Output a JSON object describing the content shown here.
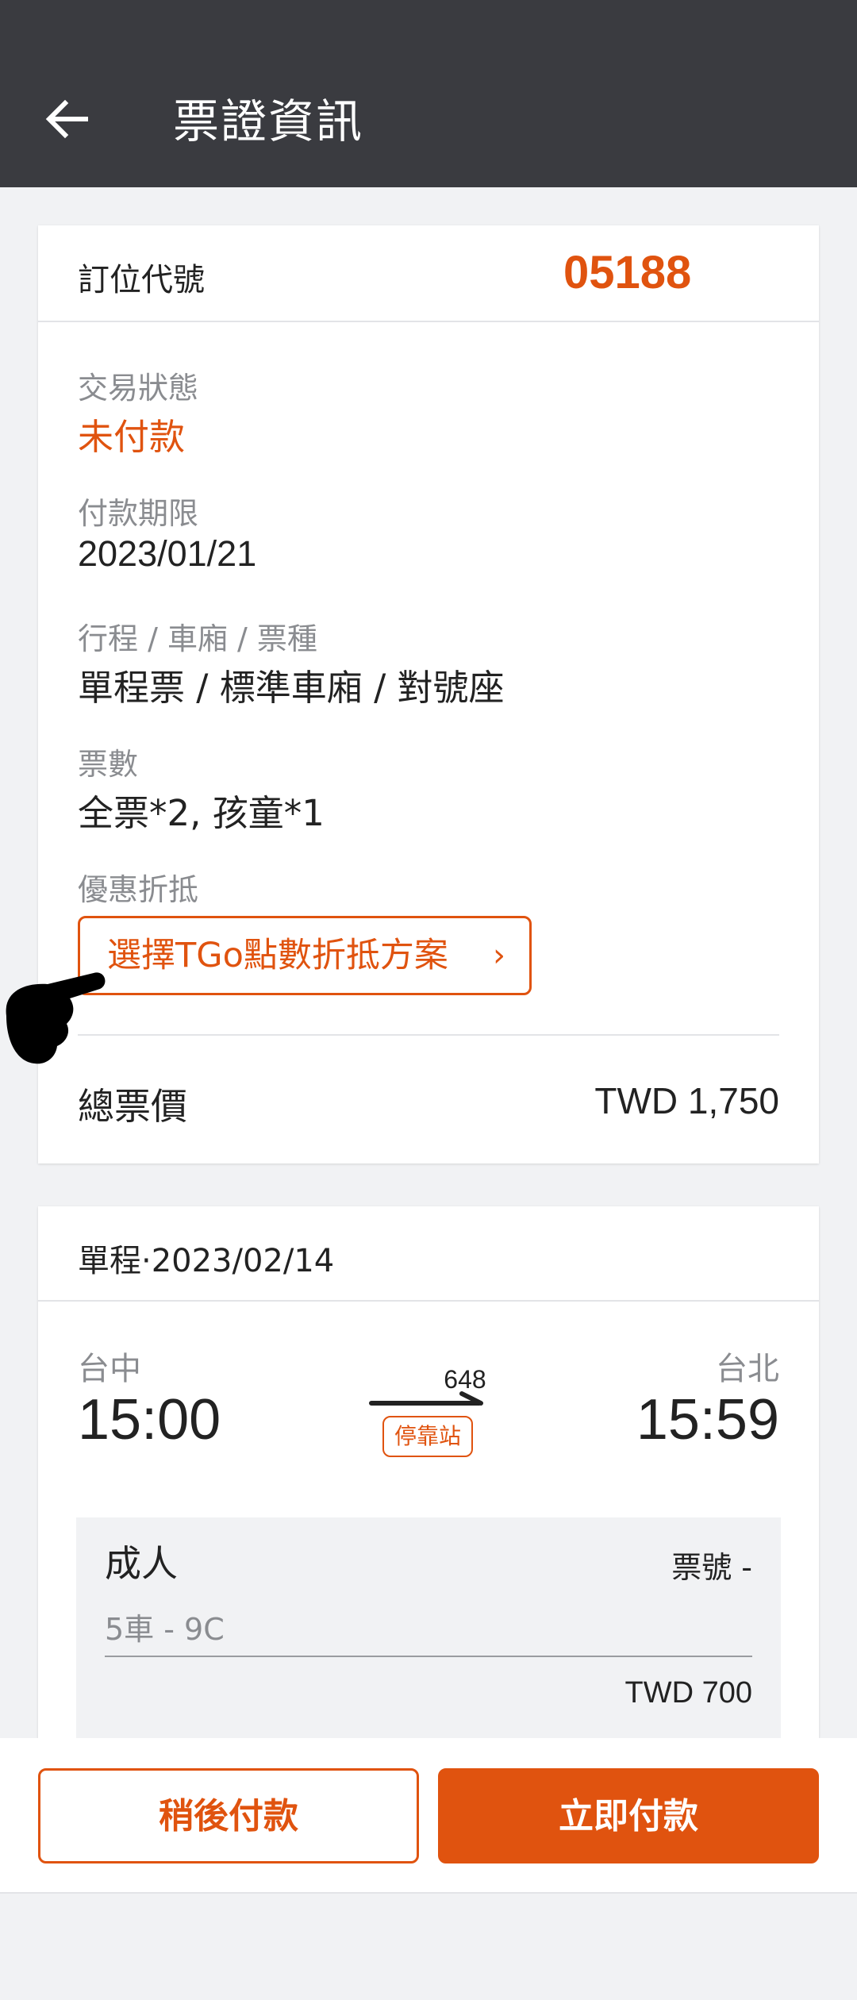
{
  "header": {
    "title": "票證資訊",
    "back_icon": "arrow-left-icon"
  },
  "booking": {
    "code_label": "訂位代號",
    "code": "05188",
    "status_label": "交易狀態",
    "status_value": "未付款",
    "deadline_label": "付款期限",
    "deadline_value": "2023/01/21",
    "itinerary_label": "行程 / 車廂 / 票種",
    "itinerary_value": "單程票 / 標準車廂 / 對號座",
    "tickets_label": "票數",
    "tickets_value": "全票*2, 孩童*1",
    "discount_label": "優惠折抵",
    "discount_button": "選擇TGo點數折抵方案",
    "discount_chevron": "›",
    "total_label": "總票價",
    "total_value": "TWD 1,750"
  },
  "trip": {
    "header": "單程·2023/02/14",
    "origin": "台中",
    "origin_time": "15:00",
    "destination": "台北",
    "destination_time": "15:59",
    "train_no": "648",
    "stop_badge": "停靠站",
    "passenger": {
      "type": "成人",
      "ticket_no": "票號 -",
      "seat": "5車 - 9C",
      "price": "TWD 700"
    }
  },
  "actions": {
    "later": "稍後付款",
    "now": "立即付款"
  },
  "colors": {
    "accent": "#e0530f",
    "appbar": "#3a3b40",
    "background": "#f1f2f4"
  }
}
